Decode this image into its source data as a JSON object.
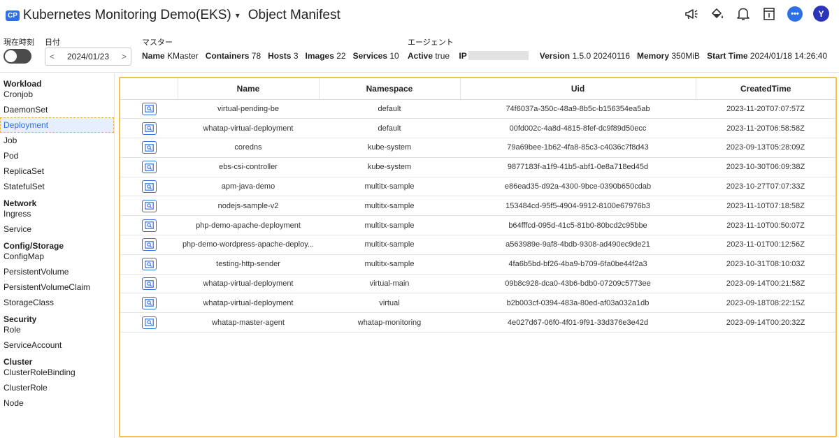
{
  "header": {
    "badge": "CP",
    "project_name": "Kubernetes Monitoring Demo(EKS)",
    "caret": "▾",
    "page_title": "Object Manifest",
    "avatar_letter": "Y",
    "chat_glyph": "•••"
  },
  "infobar": {
    "realtime_label": "現在時刻",
    "date_label": "日付",
    "date_value": "2024/01/23",
    "prev_arrow": "<",
    "next_arrow": ">",
    "master_label": "マスター",
    "agent_label": "エージェント",
    "master": {
      "name_key": "Name",
      "name_val": "KMaster",
      "containers_key": "Containers",
      "containers_val": "78",
      "hosts_key": "Hosts",
      "hosts_val": "3",
      "images_key": "Images",
      "images_val": "22",
      "services_key": "Services",
      "services_val": "10"
    },
    "agent": {
      "active_key": "Active",
      "active_val": "true",
      "ip_key": "IP",
      "version_key": "Version",
      "version_val": "1.5.0 20240116",
      "memory_key": "Memory",
      "memory_val": "350MiB",
      "start_key": "Start Time",
      "start_val": "2024/01/18 14:26:40"
    }
  },
  "sidebar": {
    "groups": [
      {
        "title": "Workload",
        "items": [
          "Cronjob",
          "DaemonSet",
          "Deployment",
          "Job",
          "Pod",
          "ReplicaSet",
          "StatefulSet"
        ]
      },
      {
        "title": "Network",
        "items": [
          "Ingress",
          "Service"
        ]
      },
      {
        "title": "Config/Storage",
        "items": [
          "ConfigMap",
          "PersistentVolume",
          "PersistentVolumeClaim",
          "StorageClass"
        ]
      },
      {
        "title": "Security",
        "items": [
          "Role",
          "ServiceAccount"
        ]
      },
      {
        "title": "Cluster",
        "items": [
          "ClusterRoleBinding",
          "ClusterRole",
          "Node"
        ]
      }
    ],
    "active": "Deployment"
  },
  "table": {
    "columns": [
      "",
      "Name",
      "Namespace",
      "Uid",
      "CreatedTime"
    ],
    "rows": [
      [
        "virtual-pending-be",
        "default",
        "74f6037a-350c-48a9-8b5c-b156354ea5ab",
        "2023-11-20T07:07:57Z"
      ],
      [
        "whatap-virtual-deployment",
        "default",
        "00fd002c-4a8d-4815-8fef-dc9f89d50ecc",
        "2023-11-20T06:58:58Z"
      ],
      [
        "coredns",
        "kube-system",
        "79a69bee-1b62-4fa8-85c3-c4036c7f8d43",
        "2023-09-13T05:28:09Z"
      ],
      [
        "ebs-csi-controller",
        "kube-system",
        "9877183f-a1f9-41b5-abf1-0e8a718ed45d",
        "2023-10-30T06:09:38Z"
      ],
      [
        "apm-java-demo",
        "multitx-sample",
        "e86ead35-d92a-4300-9bce-0390b650cdab",
        "2023-10-27T07:07:33Z"
      ],
      [
        "nodejs-sample-v2",
        "multitx-sample",
        "153484cd-95f5-4904-9912-8100e67976b3",
        "2023-11-10T07:18:58Z"
      ],
      [
        "php-demo-apache-deployment",
        "multitx-sample",
        "b64fffcd-095d-41c5-81b0-80bcd2c95bbe",
        "2023-11-10T00:50:07Z"
      ],
      [
        "php-demo-wordpress-apache-deploy...",
        "multitx-sample",
        "a563989e-9af8-4bdb-9308-ad490ec9de21",
        "2023-11-01T00:12:56Z"
      ],
      [
        "testing-http-sender",
        "multitx-sample",
        "4fa6b5bd-bf26-4ba9-b709-6fa0be44f2a3",
        "2023-10-31T08:10:03Z"
      ],
      [
        "whatap-virtual-deployment",
        "virtual-main",
        "09b8c928-dca0-43b6-bdb0-07209c5773ee",
        "2023-09-14T00:21:58Z"
      ],
      [
        "whatap-virtual-deployment",
        "virtual",
        "b2b003cf-0394-483a-80ed-af03a032a1db",
        "2023-09-18T08:22:15Z"
      ],
      [
        "whatap-master-agent",
        "whatap-monitoring",
        "4e027d67-06f0-4f01-9f91-33d376e3e42d",
        "2023-09-14T00:20:32Z"
      ]
    ]
  },
  "colors": {
    "accent": "#2f6fe4",
    "highlight_border": "#f2c14e",
    "active_bg": "#e6efff"
  },
  "icons": [
    "announcement-icon",
    "paint-bucket-icon",
    "bell-icon",
    "document-icon",
    "chat-icon",
    "avatar",
    "view-manifest-icon"
  ]
}
